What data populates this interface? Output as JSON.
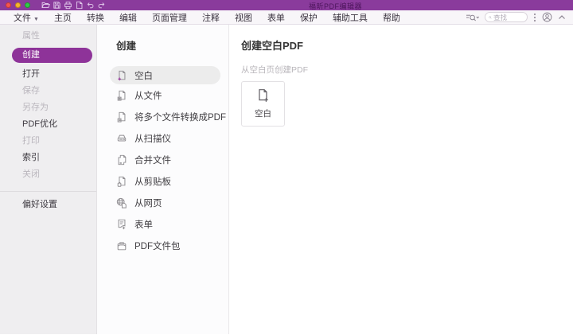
{
  "window": {
    "title": "福昕PDF编辑器"
  },
  "titlebar": {
    "traffic_lights": [
      "close",
      "minimize",
      "zoom"
    ],
    "quick_access": [
      "open-folder-icon",
      "save-icon",
      "print-icon",
      "new-document-icon",
      "undo-icon",
      "redo-icon"
    ]
  },
  "menubar": {
    "items": [
      {
        "label": "文件",
        "has_dropdown": true
      },
      {
        "label": "主页"
      },
      {
        "label": "转换"
      },
      {
        "label": "编辑"
      },
      {
        "label": "页面管理"
      },
      {
        "label": "注释"
      },
      {
        "label": "视图"
      },
      {
        "label": "表单"
      },
      {
        "label": "保护"
      },
      {
        "label": "辅助工具"
      },
      {
        "label": "帮助"
      }
    ],
    "search": {
      "placeholder": "查找"
    },
    "right_icons": [
      "search-options-icon",
      "more-options-icon",
      "account-icon",
      "collapse-toolbar-icon"
    ]
  },
  "sidebar": {
    "items": [
      {
        "label": "属性",
        "state": "disabled"
      },
      {
        "label": "创建",
        "state": "selected"
      },
      {
        "label": "打开",
        "state": "enabled"
      },
      {
        "label": "保存",
        "state": "disabled"
      },
      {
        "label": "另存为",
        "state": "disabled"
      },
      {
        "label": "PDF优化",
        "state": "enabled"
      },
      {
        "label": "打印",
        "state": "disabled"
      },
      {
        "label": "索引",
        "state": "enabled"
      },
      {
        "label": "关闭",
        "state": "disabled"
      }
    ],
    "footer": {
      "label": "偏好设置"
    }
  },
  "create_panel": {
    "header": "创建",
    "items": [
      {
        "label": "空白",
        "icon": "blank-document-icon",
        "selected": true
      },
      {
        "label": "从文件",
        "icon": "from-file-icon"
      },
      {
        "label": "将多个文件转换成PDF",
        "icon": "convert-multiple-files-icon"
      },
      {
        "label": "从扫描仪",
        "icon": "scanner-icon"
      },
      {
        "label": "合并文件",
        "icon": "combine-files-icon"
      },
      {
        "label": "从剪贴板",
        "icon": "clipboard-icon"
      },
      {
        "label": "从网页",
        "icon": "webpage-icon"
      },
      {
        "label": "表单",
        "icon": "form-icon"
      },
      {
        "label": "PDF文件包",
        "icon": "pdf-portfolio-icon"
      }
    ]
  },
  "detail_panel": {
    "header": "创建空白PDF",
    "subtitle": "从空白页创建PDF",
    "card": {
      "label": "空白",
      "icon": "blank-document-icon"
    }
  },
  "colors": {
    "titlebar": "#8a3b9c",
    "accent": "#8e3399",
    "selected_item_bg": "#ececec",
    "sidebar_bg": "#efeef0"
  }
}
